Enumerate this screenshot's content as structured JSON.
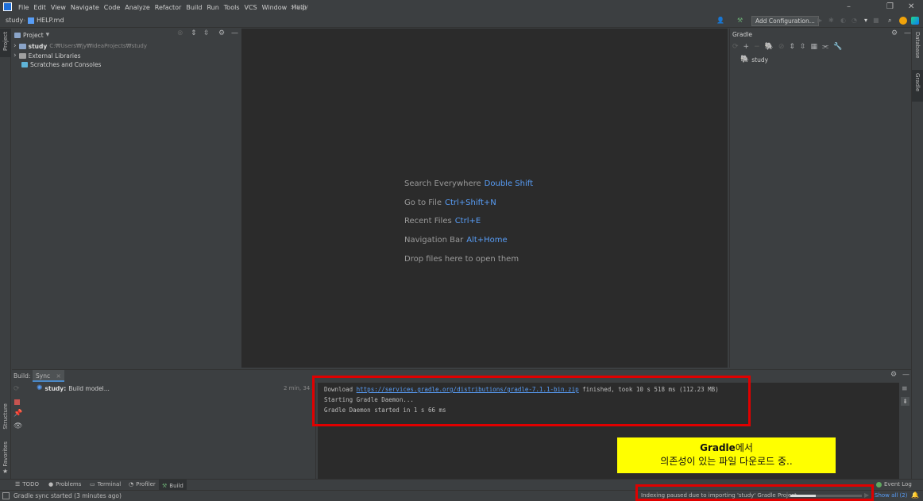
{
  "menubar": {
    "items": [
      "File",
      "Edit",
      "View",
      "Navigate",
      "Code",
      "Analyze",
      "Refactor",
      "Build",
      "Run",
      "Tools",
      "VCS",
      "Window",
      "Help"
    ],
    "window_title": "study"
  },
  "navbar": {
    "project": "study",
    "file": "HELP.md",
    "add_config": "Add Configuration..."
  },
  "left_strip": {
    "project": "Project",
    "structure": "Structure",
    "favorites": "Favorites"
  },
  "right_strip": {
    "database": "Database",
    "gradle": "Gradle"
  },
  "project_pane": {
    "title": "Project",
    "tree": [
      {
        "label": "study",
        "path": "C:₩Users₩jy₩IdeaProjects₩study"
      },
      {
        "label": "External Libraries"
      },
      {
        "label": "Scratches and Consoles"
      }
    ]
  },
  "editor": {
    "hints": [
      {
        "label": "Search Everywhere",
        "key": "Double Shift"
      },
      {
        "label": "Go to File",
        "key": "Ctrl+Shift+N"
      },
      {
        "label": "Recent Files",
        "key": "Ctrl+E"
      },
      {
        "label": "Navigation Bar",
        "key": "Alt+Home"
      },
      {
        "label": "Drop files here to open them",
        "key": ""
      }
    ]
  },
  "gradle_pane": {
    "title": "Gradle",
    "root": "study"
  },
  "build_pane": {
    "label": "Build:",
    "tab": "Sync",
    "task": {
      "name": "study:",
      "detail": "Build model...",
      "time": "2 min, 34 s"
    },
    "console": {
      "line1_prefix": "Download ",
      "line1_link": "https://services.gradle.org/distributions/gradle-7.1.1-bin.zip",
      "line1_suffix": " finished, took 10 s 518 ms (112.23 MB)",
      "line2": "Starting Gradle Daemon...",
      "line3": "Gradle Daemon started in 1 s 66 ms"
    }
  },
  "annotation": {
    "line1_bold": "Gradle",
    "line1_rest": "에서",
    "line2": "의존성이 있는 파일 다운로드 중.."
  },
  "bottom_tabs": [
    "TODO",
    "Problems",
    "Terminal",
    "Profiler",
    "Build"
  ],
  "event_log": "Event Log",
  "status": {
    "left": "Gradle sync started (3 minutes ago)",
    "indexing": "Indexing paused due to importing 'study' Gradle Project",
    "show_all": "Show all (2)",
    "progress": 0.35
  },
  "colors": {
    "accent_link": "#589df6",
    "annotation_bg": "#ffff00",
    "highlight_border": "#e00000"
  }
}
